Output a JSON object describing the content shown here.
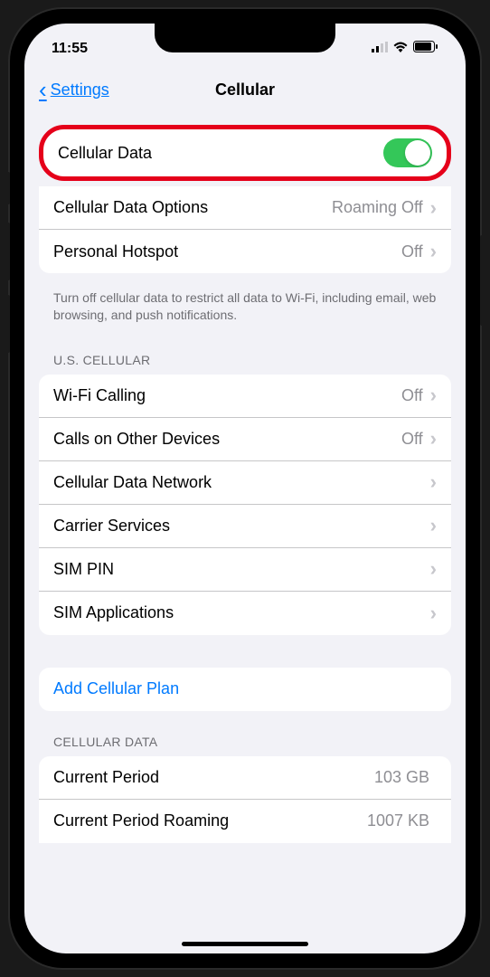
{
  "status": {
    "time": "11:55"
  },
  "nav": {
    "back_label": "Settings",
    "title": "Cellular"
  },
  "group1": {
    "cellular_data": {
      "label": "Cellular Data",
      "on": true
    },
    "options": {
      "label": "Cellular Data Options",
      "value": "Roaming Off"
    },
    "hotspot": {
      "label": "Personal Hotspot",
      "value": "Off"
    },
    "footer": "Turn off cellular data to restrict all data to Wi-Fi, including email, web browsing, and push notifications."
  },
  "carrier": {
    "header": "U.S. CELLULAR",
    "wifi_calling": {
      "label": "Wi-Fi Calling",
      "value": "Off"
    },
    "other_devices": {
      "label": "Calls on Other Devices",
      "value": "Off"
    },
    "data_network": {
      "label": "Cellular Data Network"
    },
    "carrier_services": {
      "label": "Carrier Services"
    },
    "sim_pin": {
      "label": "SIM PIN"
    },
    "sim_apps": {
      "label": "SIM Applications"
    }
  },
  "add_plan": {
    "label": "Add Cellular Plan"
  },
  "usage": {
    "header": "CELLULAR DATA",
    "current_period": {
      "label": "Current Period",
      "value": "103 GB"
    },
    "roaming": {
      "label": "Current Period Roaming",
      "value": "1007 KB"
    }
  }
}
